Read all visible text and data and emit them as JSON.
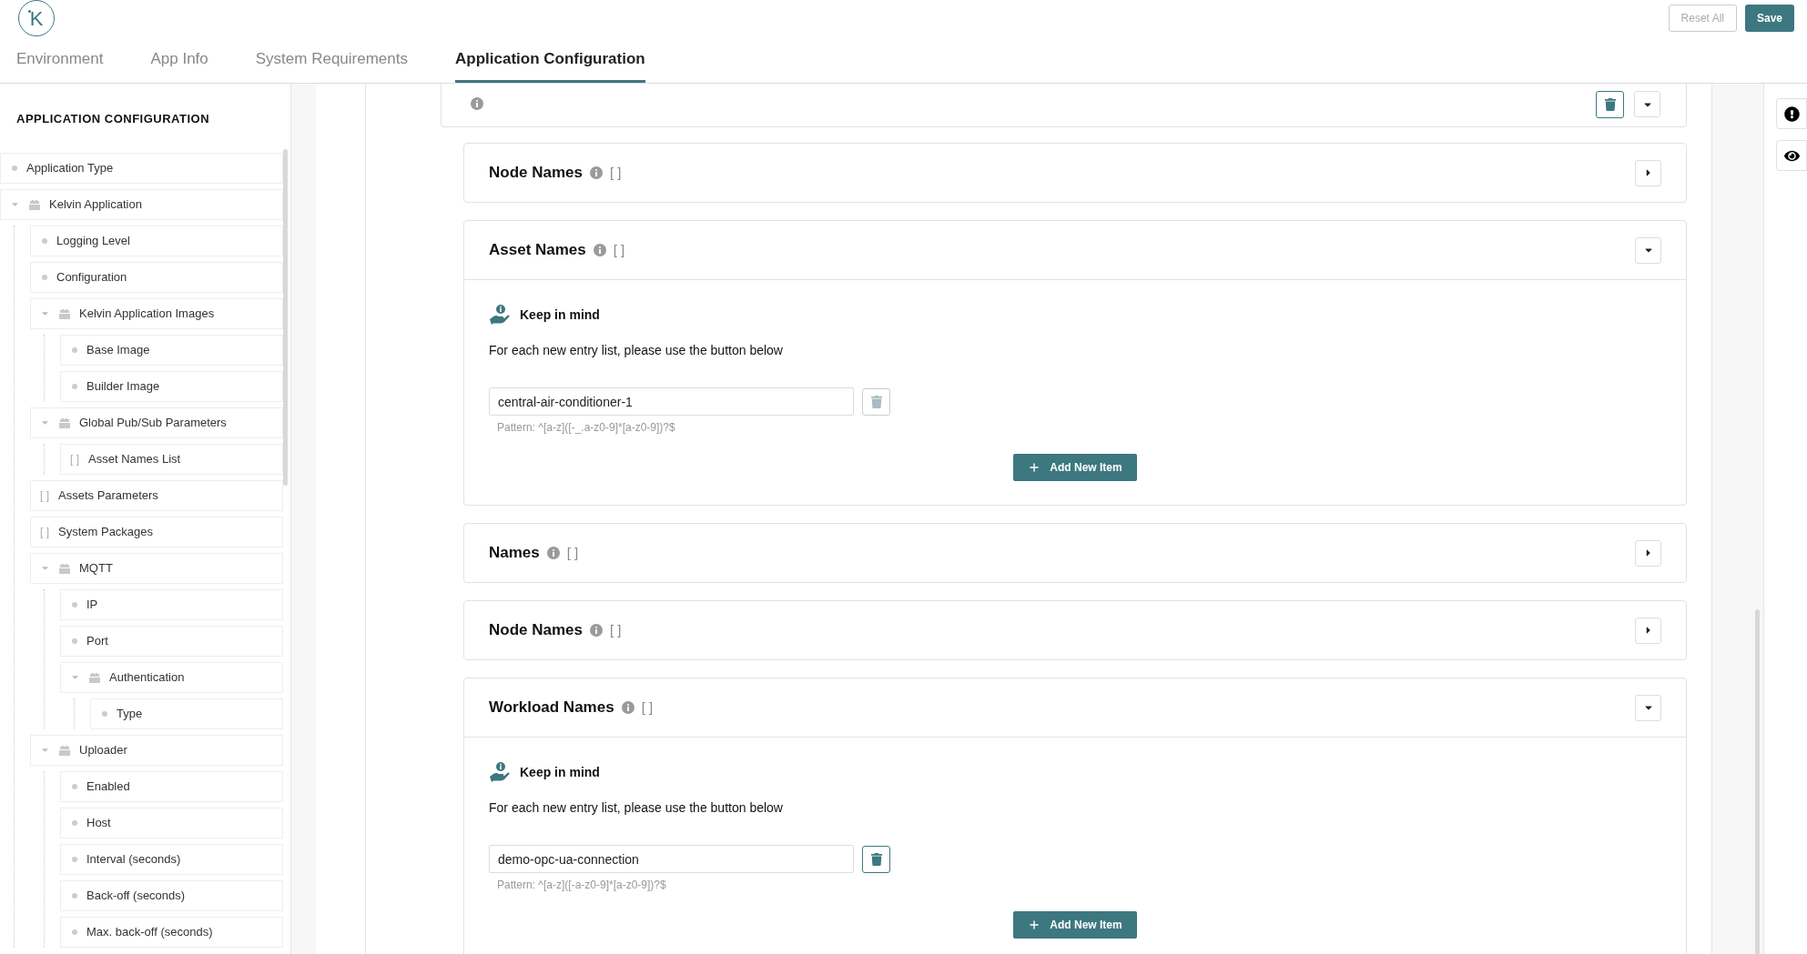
{
  "header": {
    "logo_letter": "K",
    "buttons": [
      {
        "label": "Reset All",
        "kind": "secondary"
      },
      {
        "label": "Save",
        "kind": "primary"
      }
    ]
  },
  "tabs": [
    {
      "label": "Environment",
      "selected": false
    },
    {
      "label": "App Info",
      "selected": false
    },
    {
      "label": "System Requirements",
      "selected": false
    },
    {
      "label": "Application Configuration",
      "selected": true
    }
  ],
  "sidebar": {
    "title": "APPLICATION CONFIGURATION",
    "items": [
      {
        "label": "Application Type",
        "kind": "field"
      },
      {
        "label": "Kelvin Application",
        "kind": "group",
        "expanded": true,
        "children": [
          {
            "label": "Logging Level",
            "kind": "field"
          },
          {
            "label": "Configuration",
            "kind": "field"
          },
          {
            "label": "Kelvin Application Images",
            "kind": "group",
            "expanded": true,
            "children": [
              {
                "label": "Base Image",
                "kind": "field"
              },
              {
                "label": "Builder Image",
                "kind": "field"
              }
            ]
          },
          {
            "label": "Global Pub/Sub Parameters",
            "kind": "group",
            "expanded": true,
            "children": [
              {
                "label": "Asset Names List",
                "kind": "list",
                "marker": "[ ]"
              }
            ]
          },
          {
            "label": "Assets Parameters",
            "kind": "list",
            "marker": "[ ]"
          },
          {
            "label": "System Packages",
            "kind": "list",
            "marker": "[ ]"
          },
          {
            "label": "MQTT",
            "kind": "group",
            "expanded": true,
            "children": [
              {
                "label": "IP",
                "kind": "field"
              },
              {
                "label": "Port",
                "kind": "field"
              },
              {
                "label": "Authentication",
                "kind": "group",
                "expanded": true,
                "children": [
                  {
                    "label": "Type",
                    "kind": "field"
                  }
                ]
              }
            ]
          },
          {
            "label": "Uploader",
            "kind": "group",
            "expanded": true,
            "children": [
              {
                "label": "Enabled",
                "kind": "field"
              },
              {
                "label": "Host",
                "kind": "field"
              },
              {
                "label": "Interval (seconds)",
                "kind": "field"
              },
              {
                "label": "Back-off (seconds)",
                "kind": "field"
              },
              {
                "label": "Max. back-off (seconds)",
                "kind": "field"
              }
            ]
          }
        ]
      }
    ]
  },
  "main": {
    "parent_card": {
      "delete_disabled": false,
      "expanded": true
    },
    "sections": [
      {
        "title": "Node Names",
        "marker": "[ ]",
        "expanded": false
      },
      {
        "title": "Asset Names",
        "marker": "[ ]",
        "expanded": true,
        "notice_title": "Keep in mind",
        "notice_text": "For each new entry list, please use the button below",
        "items": [
          {
            "value": "central-air-conditioner-1",
            "delete_disabled": true
          }
        ],
        "pattern": "Pattern: ^[a-z]([-_.a-z0-9]*[a-z0-9])?$",
        "add_button": "Add New Item"
      },
      {
        "title": "Names",
        "marker": "[ ]",
        "expanded": false
      },
      {
        "title": "Node Names",
        "marker": "[ ]",
        "expanded": false
      },
      {
        "title": "Workload Names",
        "marker": "[ ]",
        "expanded": true,
        "notice_title": "Keep in mind",
        "notice_text": "For each new entry list, please use the button below",
        "items": [
          {
            "value": "demo-opc-ua-connection",
            "delete_disabled": false
          }
        ],
        "pattern": "Pattern: ^[a-z]([-a-z0-9]*[a-z0-9])?$",
        "add_button": "Add New Item"
      }
    ]
  }
}
